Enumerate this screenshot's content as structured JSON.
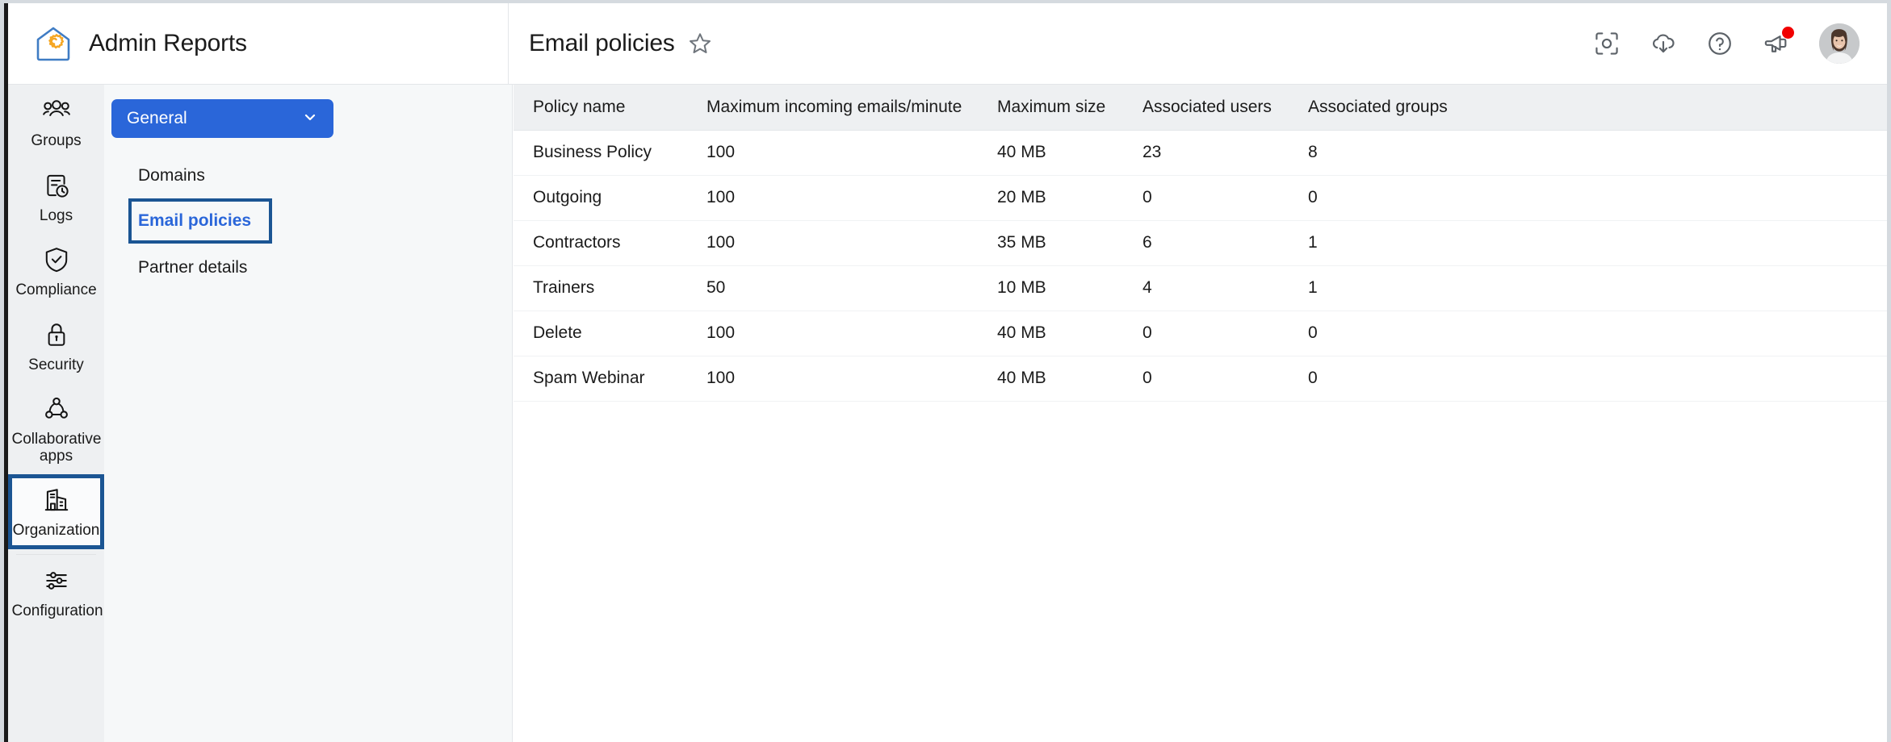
{
  "brand": {
    "title": "Admin Reports",
    "logo_icon": "house-gear-icon"
  },
  "header": {
    "page_title": "Email policies",
    "favorite_icon": "star-outline-icon",
    "actions": [
      {
        "name": "screenshot-icon",
        "label": "Capture"
      },
      {
        "name": "cloud-download-icon",
        "label": "Download"
      },
      {
        "name": "help-icon",
        "label": "Help"
      },
      {
        "name": "announcement-icon",
        "label": "Announcements",
        "badge": true
      }
    ],
    "avatar_name": "user-avatar"
  },
  "rail": {
    "items": [
      {
        "label": "Groups",
        "icon": "group-people-icon",
        "selected": false
      },
      {
        "label": "Logs",
        "icon": "log-clock-icon",
        "selected": false
      },
      {
        "label": "Compliance",
        "icon": "shield-check-icon",
        "selected": false
      },
      {
        "label": "Security",
        "icon": "lock-icon",
        "selected": false
      },
      {
        "label": "Collaborative apps",
        "icon": "network-nodes-icon",
        "selected": false
      },
      {
        "label": "Organization",
        "icon": "building-icon",
        "selected": true
      },
      {
        "label": "Configuration",
        "icon": "sliders-icon",
        "selected": false
      }
    ]
  },
  "subnav": {
    "dropdown_label": "General",
    "dropdown_icon": "chevron-down-icon",
    "items": [
      {
        "label": "Domains",
        "active": false
      },
      {
        "label": "Email policies",
        "active": true
      },
      {
        "label": "Partner details",
        "active": false
      }
    ]
  },
  "table": {
    "columns": [
      "Policy name",
      "Maximum incoming emails/minute",
      "Maximum size",
      "Associated users",
      "Associated groups"
    ],
    "rows": [
      {
        "name": "Business Policy",
        "rate": "100",
        "size": "40 MB",
        "users": "23",
        "groups": "8"
      },
      {
        "name": "Outgoing",
        "rate": "100",
        "size": "20 MB",
        "users": "0",
        "groups": "0"
      },
      {
        "name": "Contractors",
        "rate": "100",
        "size": "35 MB",
        "users": "6",
        "groups": "1"
      },
      {
        "name": "Trainers",
        "rate": "50",
        "size": "10 MB",
        "users": "4",
        "groups": "1"
      },
      {
        "name": "Delete",
        "rate": "100",
        "size": "40 MB",
        "users": "0",
        "groups": "0"
      },
      {
        "name": "Spam Webinar",
        "rate": "100",
        "size": "40 MB",
        "users": "0",
        "groups": "0"
      }
    ]
  },
  "colors": {
    "accent_blue": "#2a66d9",
    "focus_outline": "#1b5593",
    "badge_red": "#f10000",
    "rail_bg": "#eef0f2",
    "subnav_bg": "#f6f8f9"
  }
}
